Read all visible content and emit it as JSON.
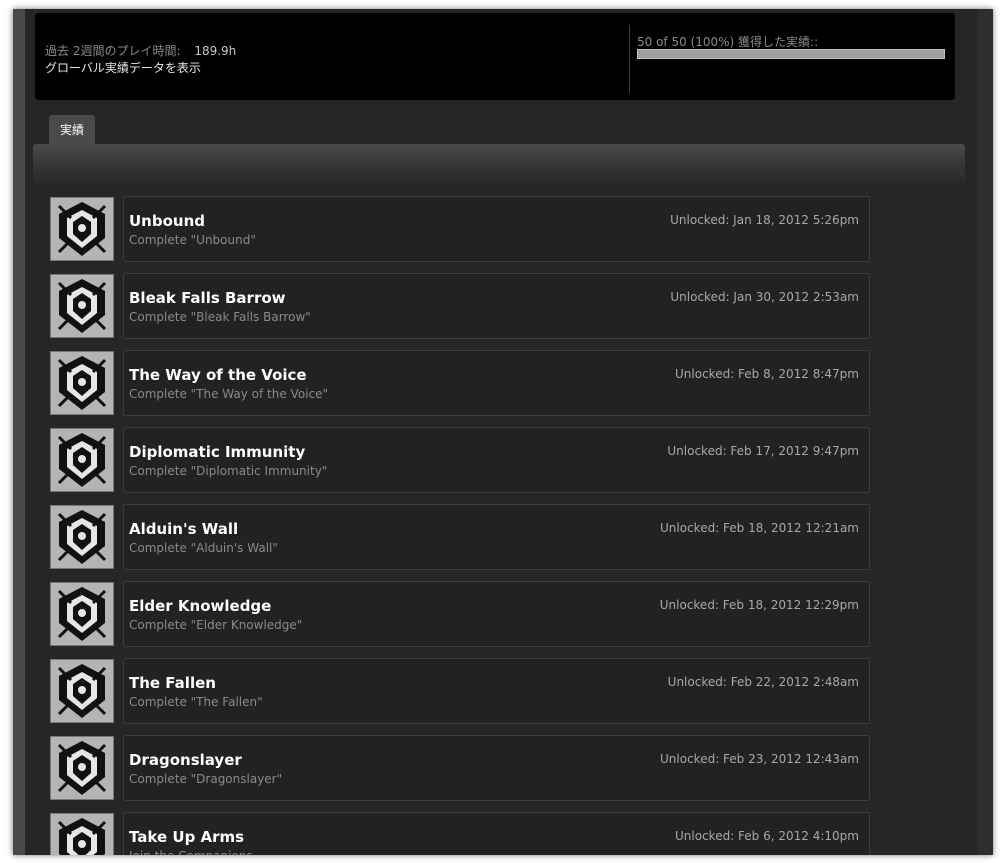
{
  "header": {
    "playtime_label": "過去 2週間のプレイ時間:",
    "playtime_value": "189.9h",
    "global_link": "グローバル実績データを表示",
    "progress_label": "50 of 50 (100%) 獲得した実績::",
    "progress_fraction": 1.0
  },
  "tabs": [
    {
      "label": "実績"
    }
  ],
  "achievements": [
    {
      "title": "Unbound",
      "desc": "Complete \"Unbound\"",
      "unlocked": "Unlocked: Jan 18, 2012 5:26pm",
      "icon": "crossed-swords-dragon-icon"
    },
    {
      "title": "Bleak Falls Barrow",
      "desc": "Complete \"Bleak Falls Barrow\"",
      "unlocked": "Unlocked: Jan 30, 2012 2:53am",
      "icon": "dragon-claw-shield-icon"
    },
    {
      "title": "The Way of the Voice",
      "desc": "Complete \"The Way of the Voice\"",
      "unlocked": "Unlocked: Feb 8, 2012 8:47pm",
      "icon": "hooded-greybeard-icon"
    },
    {
      "title": "Diplomatic Immunity",
      "desc": "Complete \"Diplomatic Immunity\"",
      "unlocked": "Unlocked: Feb 17, 2012 9:47pm",
      "icon": "winged-mask-icon"
    },
    {
      "title": "Alduin's Wall",
      "desc": "Complete \"Alduin's Wall\"",
      "unlocked": "Unlocked: Feb 18, 2012 12:21am",
      "icon": "warrior-helmet-icon"
    },
    {
      "title": "Elder Knowledge",
      "desc": "Complete \"Elder Knowledge\"",
      "unlocked": "Unlocked: Feb 18, 2012 12:29pm",
      "icon": "elder-scroll-icon"
    },
    {
      "title": "The Fallen",
      "desc": "Complete \"The Fallen\"",
      "unlocked": "Unlocked: Feb 22, 2012 2:48am",
      "icon": "dragon-head-icon"
    },
    {
      "title": "Dragonslayer",
      "desc": "Complete \"Dragonslayer\"",
      "unlocked": "Unlocked: Feb 23, 2012 12:43am",
      "icon": "dragon-crest-icon"
    },
    {
      "title": "Take Up Arms",
      "desc": "Join the Companions",
      "unlocked": "Unlocked: Feb 6, 2012 4:10pm",
      "icon": "wolf-crest-icon"
    }
  ]
}
